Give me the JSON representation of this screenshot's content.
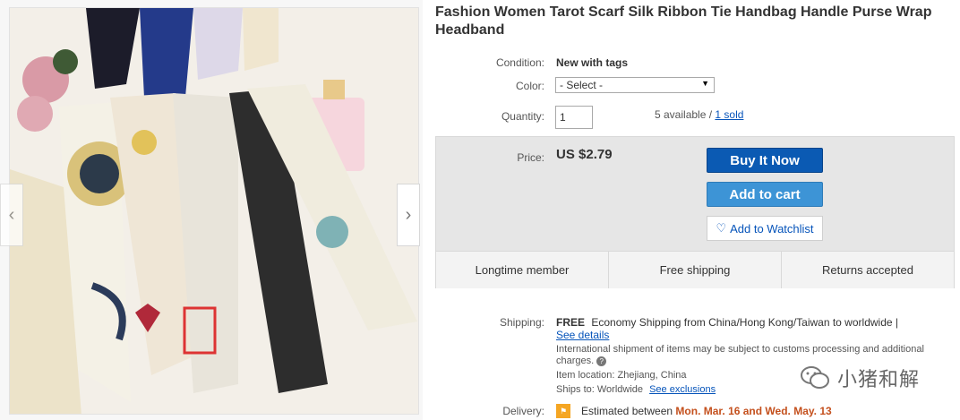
{
  "title": "Fashion Women Tarot Scarf Silk Ribbon Tie Handbag Handle Purse Wrap Headband",
  "condition": {
    "label": "Condition:",
    "value": "New with tags"
  },
  "color": {
    "label": "Color:",
    "selected": "- Select -"
  },
  "quantity": {
    "label": "Quantity:",
    "value": "1",
    "available": "5 available / ",
    "sold": "1 sold"
  },
  "price": {
    "label": "Price:",
    "value": "US $2.79"
  },
  "buttons": {
    "buy": "Buy It Now",
    "cart": "Add to cart",
    "watch": "Add to Watchlist"
  },
  "features": [
    "Longtime member",
    "Free shipping",
    "Returns accepted"
  ],
  "shipping": {
    "label": "Shipping:",
    "free": "FREE",
    "method": "Economy Shipping from China/Hong Kong/Taiwan to worldwide |",
    "details_link": "See details",
    "intl_note": "International shipment of items may be subject to customs processing and additional charges.",
    "location_label": "Item location:",
    "location": "Zhejiang, China",
    "ships_to_label": "Ships to:",
    "ships_to": "Worldwide",
    "exclusions_link": "See exclusions"
  },
  "delivery": {
    "label": "Delivery:",
    "prefix": "Estimated between ",
    "dates": "Mon. Mar. 16 and Wed. May. 13"
  },
  "watermark": "小猪和解",
  "icons": {
    "left": "chevron-left-icon",
    "right": "chevron-right-icon",
    "heart": "heart-icon",
    "help": "help-icon"
  }
}
